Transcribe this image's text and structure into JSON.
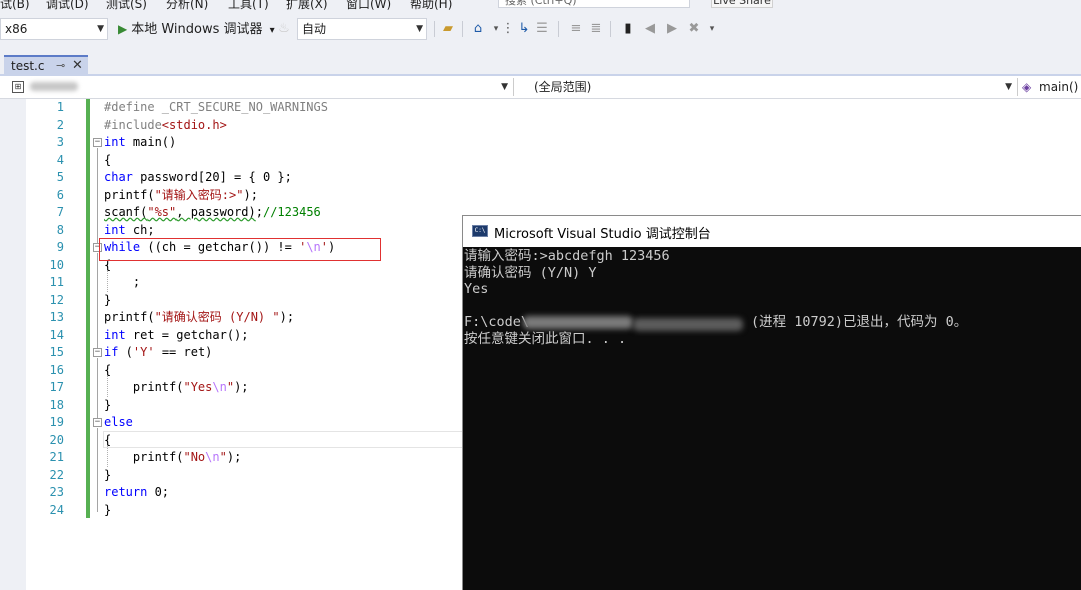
{
  "menubar": {
    "items": [
      "试(B)",
      "调试(D)",
      "测试(S)",
      "分析(N)",
      "工具(T)",
      "扩展(X)",
      "窗口(W)",
      "帮助(H)"
    ],
    "search_placeholder": "搜索 (Ctrl+Q)",
    "share_label": "Live Share"
  },
  "toolbar": {
    "platform": "x86",
    "run_label": "本地 Windows 调试器",
    "run_arrow": "▾",
    "config": "自动"
  },
  "tabs": {
    "active": "test.c",
    "pin_glyph": "⊸",
    "close_glyph": "✕"
  },
  "navbar": {
    "scope": "(全局范围)",
    "function": "main()"
  },
  "editor": {
    "line_numbers": [
      "1",
      "2",
      "3",
      "4",
      "5",
      "6",
      "7",
      "8",
      "9",
      "10",
      "11",
      "12",
      "13",
      "14",
      "15",
      "16",
      "17",
      "18",
      "19",
      "20",
      "21",
      "22",
      "23",
      "24"
    ]
  },
  "console": {
    "title": "Microsoft Visual Studio 调试控制台",
    "lines": {
      "l1": "请输入密码:>abcdefgh 123456",
      "l2": "请确认密码 (Y/N) Y",
      "l3": "Yes",
      "l5a": "F:\\code\\",
      "l5b": "(进程 10792)已退出，代码为 0。",
      "l6": "按任意键关闭此窗口. . ."
    }
  },
  "colors": {
    "keyword": "#0000ff",
    "string": "#a31515",
    "preprocessor": "#808080",
    "comment": "#008000",
    "escape": "#b776fb",
    "line_number": "#2b91af",
    "change_bar": "#57b052",
    "highlight_box": "#e03131"
  }
}
